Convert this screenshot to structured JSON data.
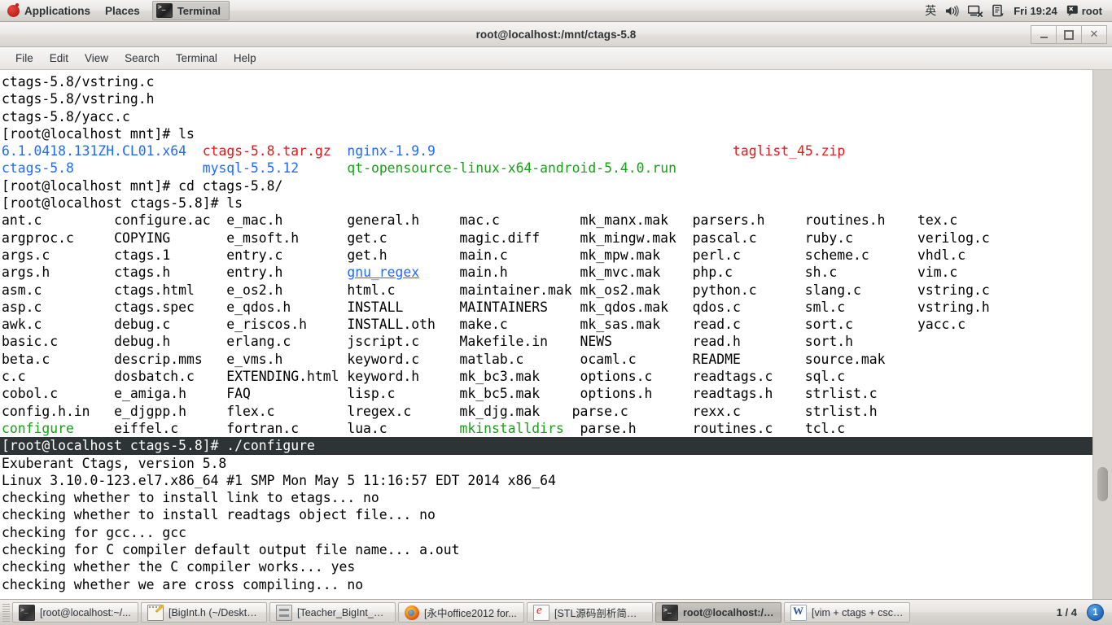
{
  "top_panel": {
    "applications_label": "Applications",
    "places_label": "Places",
    "window_tab_label": "Terminal",
    "window_tab_icon": "terminal-icon",
    "foot_icon": "gnome-foot-icon",
    "ime_label": "英",
    "volume_icon": "volume-icon",
    "network_icon": "network-disconnected-icon",
    "notes_icon": "clipboard-icon",
    "clock": "Fri 19:24",
    "user_icon": "user-message-icon",
    "user_label": "root"
  },
  "window": {
    "title": "root@localhost:/mnt/ctags-5.8",
    "controls": {
      "minimize": "minimize-button",
      "maximize": "maximize-button",
      "close": "close-button"
    },
    "menus": [
      "File",
      "Edit",
      "View",
      "Search",
      "Terminal",
      "Help"
    ]
  },
  "terminal": {
    "colors": {
      "background": "#ffffff",
      "foreground": "#000000",
      "directory_blue": "#1f6bff",
      "archive_red": "#e21a1a",
      "executable_green": "#18a018",
      "highlight_bg": "#2e3436",
      "highlight_fg": "#ffffff"
    },
    "lines": [
      {
        "type": "plain",
        "text": "ctags-5.8/vstring.c"
      },
      {
        "type": "plain",
        "text": "ctags-5.8/vstring.h"
      },
      {
        "type": "plain",
        "text": "ctags-5.8/yacc.c"
      },
      {
        "type": "plain",
        "text": "[root@localhost mnt]# ls"
      },
      {
        "type": "spans",
        "spans": [
          {
            "text": "6.1.0418.131ZH.CL01.x64",
            "color": "blue"
          },
          {
            "text": "  ",
            "color": "plain"
          },
          {
            "text": "ctags-5.8.tar.gz",
            "color": "red"
          },
          {
            "text": "  ",
            "color": "plain"
          },
          {
            "text": "nginx-1.9.9",
            "color": "blue"
          },
          {
            "text": "                                     ",
            "color": "plain"
          },
          {
            "text": "taglist_45.zip",
            "color": "red"
          }
        ]
      },
      {
        "type": "spans",
        "spans": [
          {
            "text": "ctags-5.8",
            "color": "blue"
          },
          {
            "text": "                ",
            "color": "plain"
          },
          {
            "text": "mysql-5.5.12",
            "color": "blue"
          },
          {
            "text": "      ",
            "color": "plain"
          },
          {
            "text": "qt-opensource-linux-x64-android-5.4.0.run",
            "color": "green"
          }
        ]
      },
      {
        "type": "plain",
        "text": "[root@localhost mnt]# cd ctags-5.8/"
      },
      {
        "type": "plain",
        "text": "[root@localhost ctags-5.8]# ls"
      },
      {
        "type": "plain",
        "text": "ant.c         configure.ac  e_mac.h        general.h     mac.c          mk_manx.mak   parsers.h     routines.h    tex.c"
      },
      {
        "type": "plain",
        "text": "argproc.c     COPYING       e_msoft.h      get.c         magic.diff     mk_mingw.mak  pascal.c      ruby.c        verilog.c"
      },
      {
        "type": "plain",
        "text": "args.c        ctags.1       entry.c        get.h         main.c         mk_mpw.mak    perl.c        scheme.c      vhdl.c"
      },
      {
        "type": "spans",
        "spans": [
          {
            "text": "args.h        ctags.h       entry.h        ",
            "color": "plain"
          },
          {
            "text": "gnu_regex",
            "color": "blue-link"
          },
          {
            "text": "     main.h         mk_mvc.mak    php.c         sh.c          vim.c",
            "color": "plain"
          }
        ]
      },
      {
        "type": "plain",
        "text": "asm.c         ctags.html    e_os2.h        html.c        maintainer.mak mk_os2.mak    python.c      slang.c       vstring.c"
      },
      {
        "type": "plain",
        "text": "asp.c         ctags.spec    e_qdos.h       INSTALL       MAINTAINERS    mk_qdos.mak   qdos.c        sml.c         vstring.h"
      },
      {
        "type": "plain",
        "text": "awk.c         debug.c       e_riscos.h     INSTALL.oth   make.c         mk_sas.mak    read.c        sort.c        yacc.c"
      },
      {
        "type": "plain",
        "text": "basic.c       debug.h       erlang.c       jscript.c     Makefile.in    NEWS          read.h        sort.h"
      },
      {
        "type": "plain",
        "text": "beta.c        descrip.mms   e_vms.h        keyword.c     matlab.c       ocaml.c       README        source.mak"
      },
      {
        "type": "plain",
        "text": "c.c           dosbatch.c    EXTENDING.html keyword.h     mk_bc3.mak     options.c     readtags.c    sql.c"
      },
      {
        "type": "plain",
        "text": "cobol.c       e_amiga.h     FAQ            lisp.c        mk_bc5.mak     options.h     readtags.h    strlist.c"
      },
      {
        "type": "plain",
        "text": "config.h.in   e_djgpp.h     flex.c         lregex.c      mk_djg.mak    parse.c        rexx.c        strlist.h"
      },
      {
        "type": "spans",
        "spans": [
          {
            "text": "configure",
            "color": "green"
          },
          {
            "text": "     eiffel.c      fortran.c      lua.c         ",
            "color": "plain"
          },
          {
            "text": "mkinstalldirs",
            "color": "green"
          },
          {
            "text": "  parse.h       routines.c    tcl.c",
            "color": "plain"
          }
        ]
      },
      {
        "type": "highlight",
        "text": "[root@localhost ctags-5.8]# ./configure"
      },
      {
        "type": "plain",
        "text": "Exuberant Ctags, version 5.8"
      },
      {
        "type": "plain",
        "text": "Linux 3.10.0-123.el7.x86_64 #1 SMP Mon May 5 11:16:57 EDT 2014 x86_64"
      },
      {
        "type": "plain",
        "text": "checking whether to install link to etags... no"
      },
      {
        "type": "plain",
        "text": "checking whether to install readtags object file... no"
      },
      {
        "type": "plain",
        "text": "checking for gcc... gcc"
      },
      {
        "type": "plain",
        "text": "checking for C compiler default output file name... a.out"
      },
      {
        "type": "plain",
        "text": "checking whether the C compiler works... yes"
      },
      {
        "type": "plain",
        "text": "checking whether we are cross compiling... no"
      }
    ]
  },
  "taskbar": {
    "tasks": [
      {
        "label": "[root@localhost:~/...",
        "icon": "terminal-icon",
        "icon_class": "ic-term",
        "active": false
      },
      {
        "label": "[BigInt.h (~/Desktop...",
        "icon": "text-editor-icon",
        "icon_class": "ic-note",
        "active": false
      },
      {
        "label": "[Teacher_BigInt_new]",
        "icon": "file-manager-icon",
        "icon_class": "ic-file",
        "active": false
      },
      {
        "label": "[永中office2012 for...",
        "icon": "firefox-icon",
        "icon_class": "ic-firefox",
        "active": false
      },
      {
        "label": "[STL源码剖析简体中...",
        "icon": "pdf-reader-icon",
        "icon_class": "ic-pdf",
        "active": false
      },
      {
        "label": "root@localhost:/m...",
        "icon": "terminal-icon",
        "icon_class": "ic-term",
        "active": true
      },
      {
        "label": "[vim + ctags + csco...",
        "icon": "word-document-icon",
        "icon_class": "ic-word",
        "active": false
      }
    ],
    "workspace": "1 / 4",
    "notification_count": "1"
  }
}
